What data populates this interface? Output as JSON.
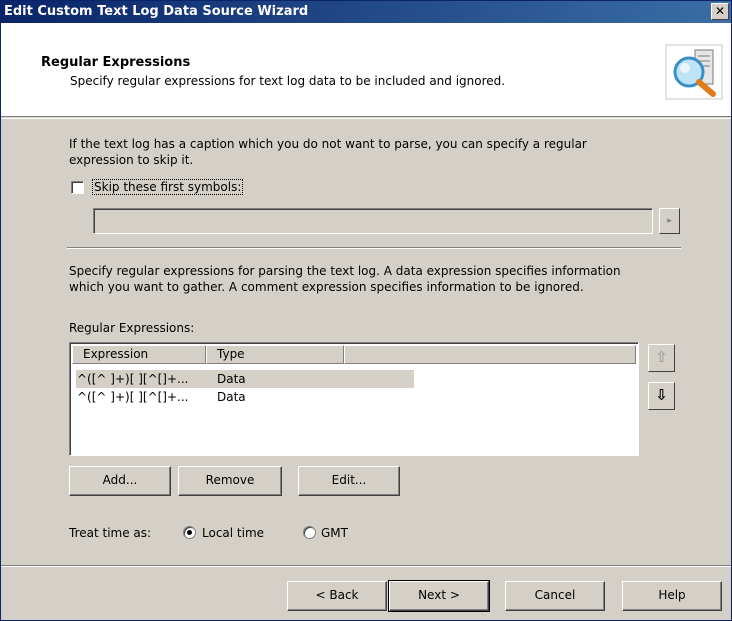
{
  "window": {
    "title": "Edit Custom Text Log Data Source Wizard",
    "close_glyph": "✕"
  },
  "header": {
    "title": "Regular Expressions",
    "subtitle": "Specify regular expressions for text log data to be included and ignored.",
    "icon": "search-data-icon"
  },
  "caption_section": {
    "description_line1": "If the text log has a caption which you do not want to parse, you can specify a regular",
    "description_line2": "expression to skip it.",
    "checkbox_label": "Skip these first symbols:",
    "checkbox_checked": false,
    "input_value": "",
    "arrow_glyph": "▸"
  },
  "parsing_section": {
    "description_line1": "Specify regular expressions for parsing the text log. A data expression specifies information",
    "description_line2": "which you want to gather. A comment expression specifies information to be ignored.",
    "list_label": "Regular Expressions:",
    "columns": [
      "Expression",
      "Type"
    ],
    "rows": [
      {
        "expression": "^([^ ]+)[ ][^[]+...",
        "type": "Data",
        "selected": true
      },
      {
        "expression": "^([^ ]+)[ ][^[]+...",
        "type": "Data",
        "selected": false
      }
    ],
    "move_up_glyph": "⇧",
    "move_down_glyph": "⇩"
  },
  "actions": {
    "add": "Add...",
    "remove": "Remove",
    "edit": "Edit..."
  },
  "time": {
    "label": "Treat time as:",
    "options": [
      "Local time",
      "GMT"
    ],
    "selected": "Local time"
  },
  "footer": {
    "back": "< Back",
    "next": "Next >",
    "cancel": "Cancel",
    "help": "Help"
  }
}
